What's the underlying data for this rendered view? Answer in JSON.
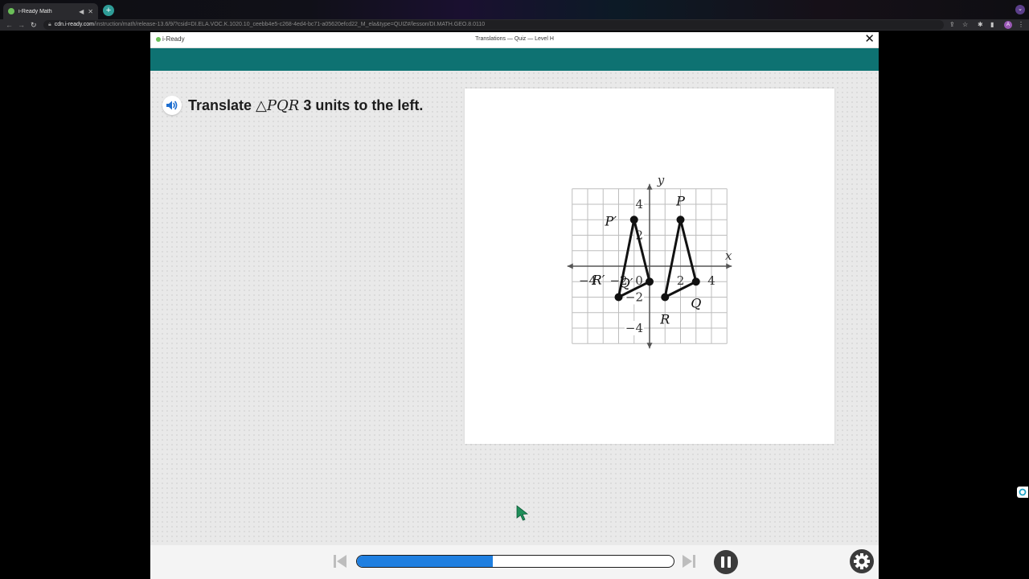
{
  "browser": {
    "tab_title": "i-Ready Math",
    "new_tab_icon": "+",
    "url_host": "cdn.i-ready.com",
    "url_path": "/instruction/math/release-13.6/9/?csid=DI.ELA.VOC.K.1020.10_ceebb4e5-c268-4ed4-bc71-a05620efcd22_M_ela&type=QUIZ#/lesson/DI.MATH.GEO.8.0110",
    "profile_initial": "A"
  },
  "app": {
    "brand": "i-Ready",
    "lesson_title": "Translations — Quiz — Level H",
    "close_label": "✕",
    "prompt_text_before": "Translate ",
    "prompt_math": "△PQR",
    "prompt_text_after": " 3 units to the left."
  },
  "chart_data": {
    "type": "scatter",
    "title": "",
    "xlabel": "x",
    "ylabel": "y",
    "xlim": [
      -5,
      5
    ],
    "ylim": [
      -5,
      5
    ],
    "grid": true,
    "x_ticks": [
      -4,
      -2,
      0,
      2,
      4
    ],
    "y_ticks": [
      4,
      2,
      -2,
      -4
    ],
    "x_tick_labels": [
      "−4",
      "−2",
      "0",
      "2",
      "4"
    ],
    "y_tick_labels": [
      "4",
      "2",
      "−2",
      "−4"
    ],
    "series": [
      {
        "name": "",
        "closed": true,
        "points": [
          {
            "label": "P",
            "x": 2,
            "y": 3
          },
          {
            "label": "Q",
            "x": 3,
            "y": -1
          },
          {
            "label": "R",
            "x": 1,
            "y": -2
          }
        ]
      },
      {
        "name": "",
        "closed": true,
        "points": [
          {
            "label": "P′",
            "x": -1,
            "y": 3
          },
          {
            "label": "Q′",
            "x": 0,
            "y": -1
          },
          {
            "label": "R′",
            "x": -2,
            "y": -2
          }
        ]
      }
    ]
  },
  "controls": {
    "progress_fraction": 0.43
  },
  "colors": {
    "teal_band": "#0e7272",
    "progress_fill": "#1f7fe0",
    "speaker_blue": "#1f6fd0"
  }
}
